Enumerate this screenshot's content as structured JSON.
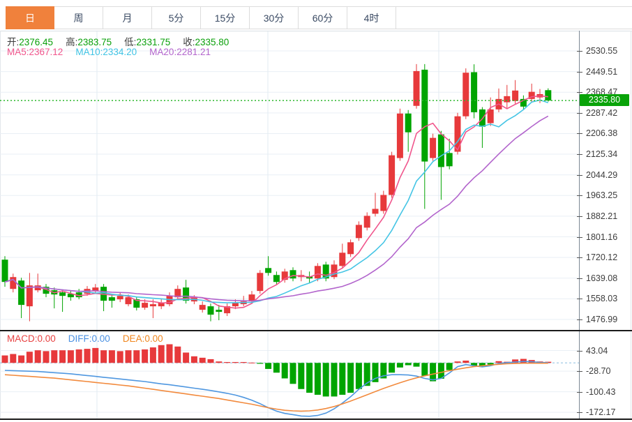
{
  "tabs": {
    "items": [
      {
        "label": "日",
        "active": true
      },
      {
        "label": "周",
        "active": false
      },
      {
        "label": "月",
        "active": false
      },
      {
        "label": "5分",
        "active": false
      },
      {
        "label": "15分",
        "active": false
      },
      {
        "label": "30分",
        "active": false
      },
      {
        "label": "60分",
        "active": false
      },
      {
        "label": "4时",
        "active": false
      }
    ],
    "active_bg": "#f0813c"
  },
  "ohlc": {
    "items": [
      {
        "label": "开:",
        "value": "2376.45"
      },
      {
        "label": "高:",
        "value": "2383.75"
      },
      {
        "label": "低:",
        "value": "2331.75"
      },
      {
        "label": "收:",
        "value": "2335.80"
      }
    ],
    "value_color": "#0aa00a"
  },
  "ma_legend": {
    "items": [
      {
        "label": "MA5:",
        "value": "2367.12",
        "color": "#f0558c"
      },
      {
        "label": "MA10:",
        "value": "2334.20",
        "color": "#3fc3e4"
      },
      {
        "label": "MA20:",
        "value": "2281.21",
        "color": "#b264cc"
      }
    ]
  },
  "macd_legend": {
    "items": [
      {
        "label": "MACD:",
        "value": "0.00",
        "color": "#e84040"
      },
      {
        "label": "DIFF:",
        "value": "0.00",
        "color": "#4a90e2"
      },
      {
        "label": "DEA:",
        "value": "0.00",
        "color": "#f0861d"
      }
    ]
  },
  "price_axis": {
    "ticks": [
      "2530.55",
      "2449.51",
      "2368.47",
      "2287.42",
      "2206.38",
      "2125.34",
      "2044.29",
      "1963.25",
      "1882.21",
      "1801.16",
      "1720.12",
      "1639.08",
      "1558.03",
      "1476.99"
    ],
    "current_price": "2335.80",
    "current_price_color": "#09a309"
  },
  "macd_axis": {
    "ticks": [
      "43.04",
      "-28.70",
      "-100.43",
      "-172.17"
    ]
  },
  "chart_data": {
    "type": "candlestick+macd",
    "up_color": "#e7393b",
    "down_color": "#00a400",
    "grid": true,
    "main": {
      "ylim": [
        1436.1,
        2607.0
      ],
      "ma_periods": [
        5,
        10,
        20
      ],
      "ma_colors": [
        "#f0558c",
        "#45c5e5",
        "#b264cc"
      ],
      "price_line_color": "#2db82d",
      "candles_ohlc": [
        [
          1711.7,
          1725.4,
          1605.3,
          1624.4
        ],
        [
          1597.0,
          1657.0,
          1583.4,
          1643.4
        ],
        [
          1629.8,
          1640.7,
          1482.4,
          1534.3
        ],
        [
          1528.8,
          1659.7,
          1470.0,
          1610.7
        ],
        [
          1591.6,
          1657.0,
          1583.4,
          1610.7
        ],
        [
          1605.3,
          1616.2,
          1564.3,
          1578.0
        ],
        [
          1591.6,
          1602.5,
          1520.6,
          1575.2
        ],
        [
          1583.4,
          1594.3,
          1507.0,
          1569.7
        ],
        [
          1578.0,
          1588.9,
          1550.6,
          1564.3
        ],
        [
          1583.4,
          1597.0,
          1556.1,
          1564.3
        ],
        [
          1578.0,
          1608.0,
          1569.7,
          1597.0
        ],
        [
          1588.9,
          1616.2,
          1578.0,
          1602.5
        ],
        [
          1605.3,
          1616.2,
          1509.7,
          1550.6
        ],
        [
          1564.3,
          1578.0,
          1523.3,
          1550.6
        ],
        [
          1556.1,
          1583.4,
          1545.2,
          1569.7
        ],
        [
          1537.0,
          1575.2,
          1528.8,
          1564.3
        ],
        [
          1556.1,
          1567.0,
          1512.4,
          1523.3
        ],
        [
          1523.3,
          1556.1,
          1515.1,
          1542.5
        ],
        [
          1528.8,
          1556.1,
          1482.4,
          1537.0
        ],
        [
          1528.8,
          1556.1,
          1517.8,
          1542.5
        ],
        [
          1537.0,
          1583.4,
          1528.8,
          1569.7
        ],
        [
          1564.3,
          1610.7,
          1556.1,
          1597.0
        ],
        [
          1602.5,
          1632.5,
          1539.7,
          1550.6
        ],
        [
          1547.9,
          1572.5,
          1537.0,
          1561.6
        ],
        [
          1515.1,
          1547.9,
          1504.2,
          1534.3
        ],
        [
          1528.8,
          1539.7,
          1470.0,
          1496.0
        ],
        [
          1515.1,
          1534.3,
          1474.2,
          1506.9
        ],
        [
          1501.5,
          1539.7,
          1490.6,
          1528.8
        ],
        [
          1528.8,
          1556.1,
          1517.8,
          1542.5
        ],
        [
          1537.0,
          1569.7,
          1528.8,
          1547.9
        ],
        [
          1547.9,
          1588.9,
          1539.7,
          1575.2
        ],
        [
          1588.9,
          1670.6,
          1578.0,
          1659.7
        ],
        [
          1678.8,
          1725.4,
          1648.8,
          1659.7
        ],
        [
          1651.5,
          1665.2,
          1613.3,
          1624.2
        ],
        [
          1632.5,
          1676.1,
          1621.5,
          1665.2
        ],
        [
          1670.6,
          1681.6,
          1626.9,
          1637.9
        ],
        [
          1643.4,
          1670.6,
          1626.9,
          1651.5
        ],
        [
          1646.1,
          1665.2,
          1618.8,
          1637.9
        ],
        [
          1637.9,
          1697.9,
          1626.9,
          1687.0
        ],
        [
          1692.5,
          1703.4,
          1626.9,
          1637.9
        ],
        [
          1643.4,
          1708.9,
          1635.2,
          1692.5
        ],
        [
          1687.0,
          1774.4,
          1676.1,
          1738.9
        ],
        [
          1733.5,
          1790.8,
          1722.6,
          1779.9
        ],
        [
          1796.3,
          1861.8,
          1785.4,
          1848.1
        ],
        [
          1837.2,
          1897.3,
          1826.3,
          1883.6
        ],
        [
          1891.8,
          1973.7,
          1880.9,
          1910.9
        ],
        [
          1902.7,
          1981.9,
          1891.8,
          1965.5
        ],
        [
          1965.5,
          2134.8,
          1954.6,
          2121.1
        ],
        [
          2110.2,
          2304.0,
          2099.3,
          2284.9
        ],
        [
          2284.9,
          2298.5,
          2134.8,
          2211.2
        ],
        [
          2314.9,
          2478.7,
          2304.0,
          2451.4
        ],
        [
          2456.8,
          2478.7,
          1910.9,
          2096.6
        ],
        [
          2110.2,
          2205.8,
          2099.3,
          2189.4
        ],
        [
          2203.0,
          2216.7,
          1946.4,
          2075.0
        ],
        [
          2130.0,
          2186.0,
          2066.0,
          2078.0
        ],
        [
          2135.0,
          2287.7,
          2124.0,
          2274.0
        ],
        [
          2274.0,
          2462.0,
          2263.0,
          2445.0
        ],
        [
          2447.0,
          2478.0,
          2266.0,
          2290.0
        ],
        [
          2301.0,
          2310.0,
          2150.0,
          2233.0
        ],
        [
          2247.0,
          2348.0,
          2236.0,
          2301.0
        ],
        [
          2301.0,
          2383.0,
          2290.0,
          2342.0
        ],
        [
          2329.0,
          2397.0,
          2307.0,
          2353.0
        ],
        [
          2334.0,
          2416.0,
          2323.0,
          2375.0
        ],
        [
          2342.0,
          2356.0,
          2299.0,
          2312.0
        ],
        [
          2342.0,
          2402.0,
          2331.0,
          2370.0
        ],
        [
          2348.0,
          2381.0,
          2326.0,
          2361.0
        ],
        [
          2376.45,
          2383.75,
          2331.75,
          2335.8
        ]
      ]
    },
    "macd": {
      "ylim": [
        -193.7,
        110.0
      ],
      "zero_line_color": "#aacfe8",
      "diff_color": "#4f97e0",
      "dea_color": "#f28a3d",
      "hist": [
        26,
        31,
        26,
        39,
        44,
        41,
        44,
        44,
        44,
        47,
        49,
        52,
        44,
        44,
        41,
        44,
        44,
        47,
        54,
        62,
        65,
        57,
        36,
        23,
        18,
        13,
        5,
        3,
        3,
        3,
        1,
        -3,
        -21,
        -34,
        -54,
        -73,
        -91,
        -104,
        -111,
        -117,
        -117,
        -111,
        -104,
        -91,
        -80,
        -67,
        -54,
        -34,
        -16,
        -8,
        -13,
        -45,
        -64,
        -55,
        -25,
        5,
        8,
        -10,
        -14,
        -6,
        6,
        4,
        12,
        14,
        10,
        5,
        4
      ],
      "diff": [
        -26,
        -27,
        -28,
        -29,
        -30,
        -32,
        -34,
        -36,
        -38,
        -41,
        -44,
        -47,
        -50,
        -53,
        -56,
        -59,
        -62,
        -65,
        -69,
        -73,
        -76,
        -80,
        -84,
        -88,
        -92,
        -96,
        -101,
        -106,
        -112,
        -120,
        -130,
        -142,
        -156,
        -168,
        -176,
        -180,
        -185,
        -186,
        -183,
        -175,
        -160,
        -140,
        -118,
        -92,
        -70,
        -54,
        -45,
        -41,
        -41,
        -42,
        -46,
        -54,
        -59,
        -54,
        -35,
        -13,
        -6,
        -10,
        -14,
        -10,
        -2,
        1,
        3,
        5,
        4,
        2,
        1
      ],
      "dea": [
        -41,
        -43,
        -45,
        -47,
        -49,
        -51,
        -53,
        -56,
        -59,
        -62,
        -65,
        -68,
        -71,
        -74,
        -77,
        -80,
        -84,
        -88,
        -92,
        -96,
        -100,
        -104,
        -108,
        -112,
        -116,
        -120,
        -124,
        -129,
        -134,
        -139,
        -144,
        -150,
        -156,
        -161,
        -165,
        -167,
        -168,
        -167,
        -164,
        -159,
        -152,
        -143,
        -133,
        -122,
        -111,
        -100,
        -89,
        -79,
        -69,
        -60,
        -52,
        -45,
        -39,
        -33,
        -27,
        -22,
        -17,
        -13,
        -10,
        -7,
        -5,
        -3,
        -2,
        -1,
        -1,
        -1,
        -1
      ]
    }
  }
}
